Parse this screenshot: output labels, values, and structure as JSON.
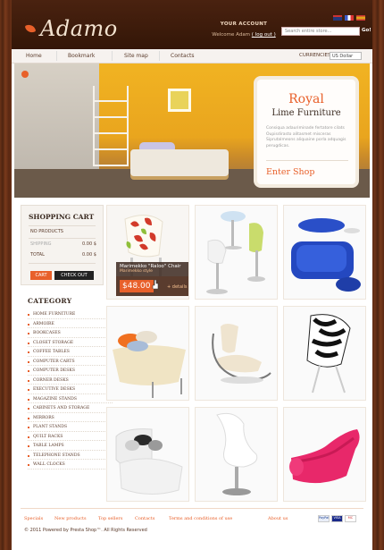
{
  "brand": {
    "logo_text": "Adamo"
  },
  "account": {
    "title": "YOUR ACCOUNT",
    "welcome": "Welcome Adam",
    "logout": "( log out )"
  },
  "search": {
    "placeholder": "Search entire store...",
    "go_label": "Go!"
  },
  "flags": [
    {
      "name": "flag-en-icon",
      "color": "#24387a"
    },
    {
      "name": "flag-fr-icon",
      "color": "#3d5cc9"
    },
    {
      "name": "flag-es-icon",
      "color": "#e2a41b"
    }
  ],
  "nav": {
    "items": [
      "Home",
      "Bookmark",
      "Site map",
      "Contacts"
    ],
    "currency_label": "CURRENCIES:",
    "currency_value": "US Dollar"
  },
  "promo": {
    "title": "Royal",
    "subtitle": "Lime Furniture",
    "description": "Consiqua adauriminade fertatore cilats Oupisdirasto alitasmet misceras Siprutalmeons aliquaine porla adquagis perugdicas.",
    "cta": "Enter Shop"
  },
  "cart": {
    "title": "SHOPPING CART",
    "no_products": "NO PRODUCTS",
    "shipping_label": "SHIPPING",
    "shipping_value": "0.00 $",
    "total_label": "TOTAL",
    "total_value": "0.00 $",
    "cart_button": "CART",
    "checkout_button": "CHECK OUT"
  },
  "categories": {
    "title": "CATEGORY",
    "items": [
      "HOME FURNITURE",
      "ARMOIRE",
      "BOOKCASES",
      "CLOSET STORAGE",
      "COFFEE TABLES",
      "COMPUTER CARTS",
      "COMPUTER DESKS",
      "CORNER DESKS",
      "EXECUTIVE DESKS",
      "MAGAZINE STANDS",
      "CABINETS AND STORAGE",
      "MIRRORS",
      "PLANT STANDS",
      "QUILT RACKS",
      "TABLE LAMPS",
      "TELEPHONE STANDS",
      "WALL CLOCKS"
    ]
  },
  "product_overlay": {
    "name": "Marimekko \"Raloo\" Chair",
    "subtitle": "Marimekko style",
    "price": "$48.00",
    "details": "+ details"
  },
  "footer": {
    "links": [
      "Specials",
      "New products",
      "Top sellers",
      "Contacts",
      "Terms and conditions of use",
      "About us"
    ],
    "copyright": "© 2011 Powered by Presta Shop™. All Rights Reserved",
    "payments": [
      "PayPal",
      "VISA",
      "MC"
    ]
  },
  "colors": {
    "accent": "#e8602a",
    "header": "#3c1a0b",
    "wood": "#5a2a14"
  }
}
